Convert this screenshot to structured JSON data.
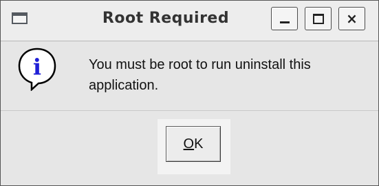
{
  "window": {
    "title": "Root Required",
    "controls": {
      "minimize_icon": "minimize-icon",
      "maximize_icon": "maximize-icon",
      "close_glyph": "×"
    }
  },
  "dialog": {
    "icon": "info-icon",
    "icon_glyph": "i",
    "message": "You must be root to run uninstall this application."
  },
  "buttons": {
    "ok_mnemonic": "O",
    "ok_rest": "K"
  },
  "colors": {
    "dialog_background": "#e6e6e6",
    "info_icon_blue": "#1f1fd6"
  }
}
